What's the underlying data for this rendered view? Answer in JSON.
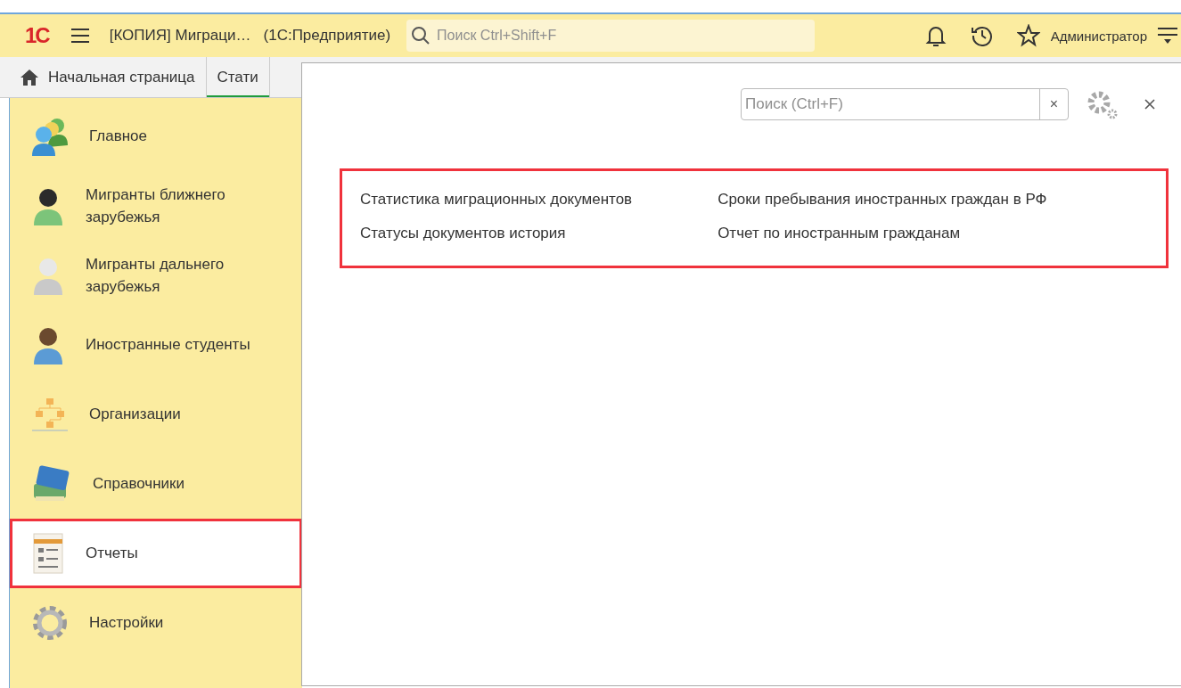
{
  "header": {
    "logo": "1С",
    "title": "[КОПИЯ] Миграци…",
    "subtitle": "(1С:Предприятие)",
    "search": {
      "placeholder": "Поиск Ctrl+Shift+F"
    },
    "user": "Администратор"
  },
  "tabs": [
    {
      "label": "Начальная страница",
      "selected": false,
      "kind": "home"
    },
    {
      "label": "Стати",
      "selected": true,
      "kind": "plain"
    }
  ],
  "sidebar": {
    "items": [
      {
        "label": "Главное",
        "kind": "people",
        "selected": false,
        "highlighted": false
      },
      {
        "label": "Мигранты ближнего зарубежья",
        "kind": "person",
        "selected": false,
        "highlighted": false
      },
      {
        "label": "Мигранты дальнего зарубежья",
        "kind": "person",
        "selected": false,
        "highlighted": false
      },
      {
        "label": "Иностранные студенты",
        "kind": "person",
        "selected": false,
        "highlighted": false
      },
      {
        "label": "Организации",
        "kind": "org",
        "selected": false,
        "highlighted": false
      },
      {
        "label": "Справочники",
        "kind": "books",
        "selected": false,
        "highlighted": false
      },
      {
        "label": "Отчеты",
        "kind": "report",
        "selected": true,
        "highlighted": true
      },
      {
        "label": "Настройки",
        "kind": "gear",
        "selected": false,
        "highlighted": false
      }
    ]
  },
  "panel": {
    "search": {
      "placeholder": "Поиск (Ctrl+F)",
      "clear": "×"
    },
    "highlighted": true,
    "columns": [
      [
        "Статистика миграционных документов",
        "Статусы документов история"
      ],
      [
        "Сроки пребывания иностранных граждан в РФ",
        "Отчет по иностранным гражданам"
      ]
    ]
  }
}
